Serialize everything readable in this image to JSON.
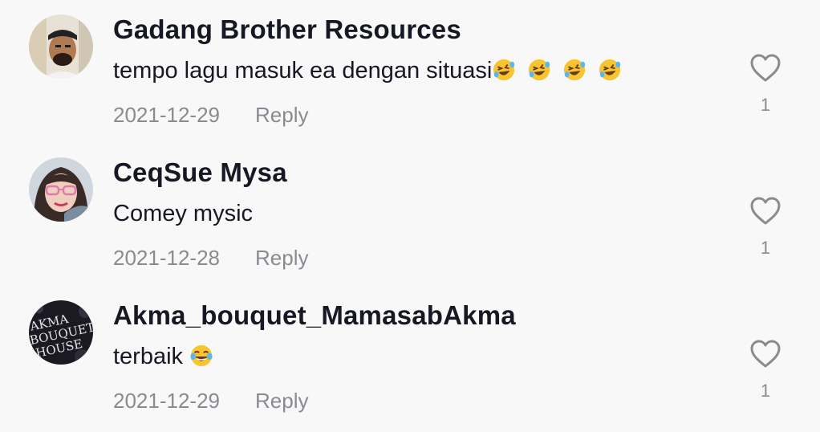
{
  "comments": [
    {
      "username": "Gadang Brother Resources",
      "text": "tempo lagu masuk ea dengan situasi",
      "emojis": [
        "rofl-emoji",
        "rofl-emoji",
        "rofl-emoji",
        "rofl-emoji"
      ],
      "date": "2021-12-29",
      "reply_label": "Reply",
      "like_count": "1",
      "avatar_icon": "avatar-photo-man"
    },
    {
      "username": "CeqSue Mysa",
      "text": "Comey mysic",
      "emojis": [],
      "date": "2021-12-28",
      "reply_label": "Reply",
      "like_count": "1",
      "avatar_icon": "avatar-photo-woman"
    },
    {
      "username": "Akma_bouquet_MamasabAkma",
      "text": "terbaik",
      "emojis": [
        "tears-of-joy-emoji"
      ],
      "date": "2021-12-29",
      "reply_label": "Reply",
      "like_count": "1",
      "avatar_icon": "avatar-logo-bouquet",
      "avatar_logo_text": [
        "AKMA",
        "BOUQUET",
        "HOUSE"
      ]
    }
  ],
  "colors": {
    "background": "#f8f8f8",
    "username": "#161823",
    "secondary": "#8a8b91"
  }
}
